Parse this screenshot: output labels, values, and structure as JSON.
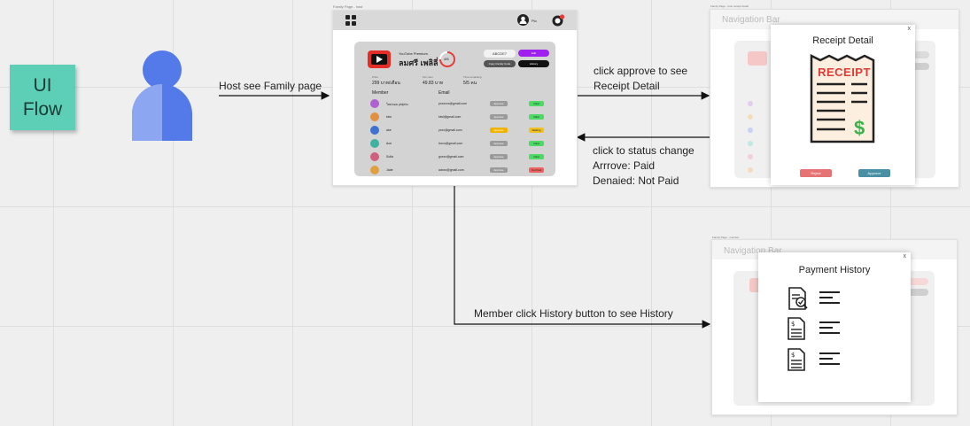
{
  "sticky": {
    "line1": "UI",
    "line2": "Flow"
  },
  "arrows": {
    "host_see": "Host see Family page",
    "approve1": "click approve to see",
    "approve2": "Receipt Detail",
    "status1": "click to status change",
    "status2": "Arrrove: Paid",
    "status3": "Denaied: Not Paid",
    "history": "Member click History button to see History"
  },
  "family_page": {
    "frame_title": "Family Page - host",
    "user_name": "Pio",
    "app_label": "YouTube Premium",
    "app_name": "ลมศรี เพลิลี่",
    "count": "4/6",
    "code": "ABCDE7",
    "edit_label": "Edit",
    "copy_label": "Copy Family Code",
    "history_label": "History",
    "price_label": "Price",
    "price_value": "299 บาท/เดือน",
    "per_label": "Per User",
    "per_value": "49.83 บาท",
    "renew_label": "Time remaining",
    "renew_value": "5/5 คน",
    "member_header": "Member",
    "email_header": "Email",
    "members": [
      {
        "name": "ใหม่หอม phiphu",
        "email": "pxxxxxx@gmail.com",
        "action": "Approve",
        "status": "Paid",
        "status_color": "#4cd964",
        "avatar": "#b060d0",
        "action_color": "#9a9a9a"
      },
      {
        "name": "kiwi",
        "email": "kiwi@gmail.com",
        "action": "Approve",
        "status": "Paid",
        "status_color": "#4cd964",
        "avatar": "#e09040",
        "action_color": "#9a9a9a"
      },
      {
        "name": "ake",
        "email": "yxxx@gmail.com",
        "action": "Approve",
        "status": "Waiting",
        "status_color": "#f0c020",
        "avatar": "#4070d0",
        "action_color": "#f0b400"
      },
      {
        "name": "Aon",
        "email": "lxxxx@gmail.com",
        "action": "Approve",
        "status": "Paid",
        "status_color": "#4cd964",
        "avatar": "#40b0a0",
        "action_color": "#9a9a9a"
      },
      {
        "name": "Sofia",
        "email": "gxxxx@gmail.com",
        "action": "Approve",
        "status": "Paid",
        "status_color": "#4cd964",
        "avatar": "#d06080",
        "action_color": "#9a9a9a"
      },
      {
        "name": "Jade",
        "email": "adxxx@gmail.com",
        "action": "Approve",
        "status": "Not Paid",
        "status_color": "#f06060",
        "avatar": "#e0a040",
        "action_color": "#9a9a9a"
      }
    ]
  },
  "receipt_page": {
    "frame_title": "Family Page - host receipt detail",
    "nav_title": "Navigation Bar",
    "modal_title": "Receipt Detail",
    "close": "x",
    "receipt_word": "RECEIPT",
    "reject_label": "Reject",
    "approve_label": "Approve",
    "reject_color": "#e57373",
    "approve_color": "#4a90a4"
  },
  "history_page": {
    "frame_title": "Family Page - member",
    "nav_title": "Navigation Bar",
    "modal_title": "Payment History",
    "close": "x"
  },
  "icons": [
    "user-icon",
    "menu-grid-icon",
    "bell-icon",
    "youtube-icon",
    "receipt-icon",
    "document-check-icon",
    "document-dollar-icon",
    "lines-icon"
  ]
}
